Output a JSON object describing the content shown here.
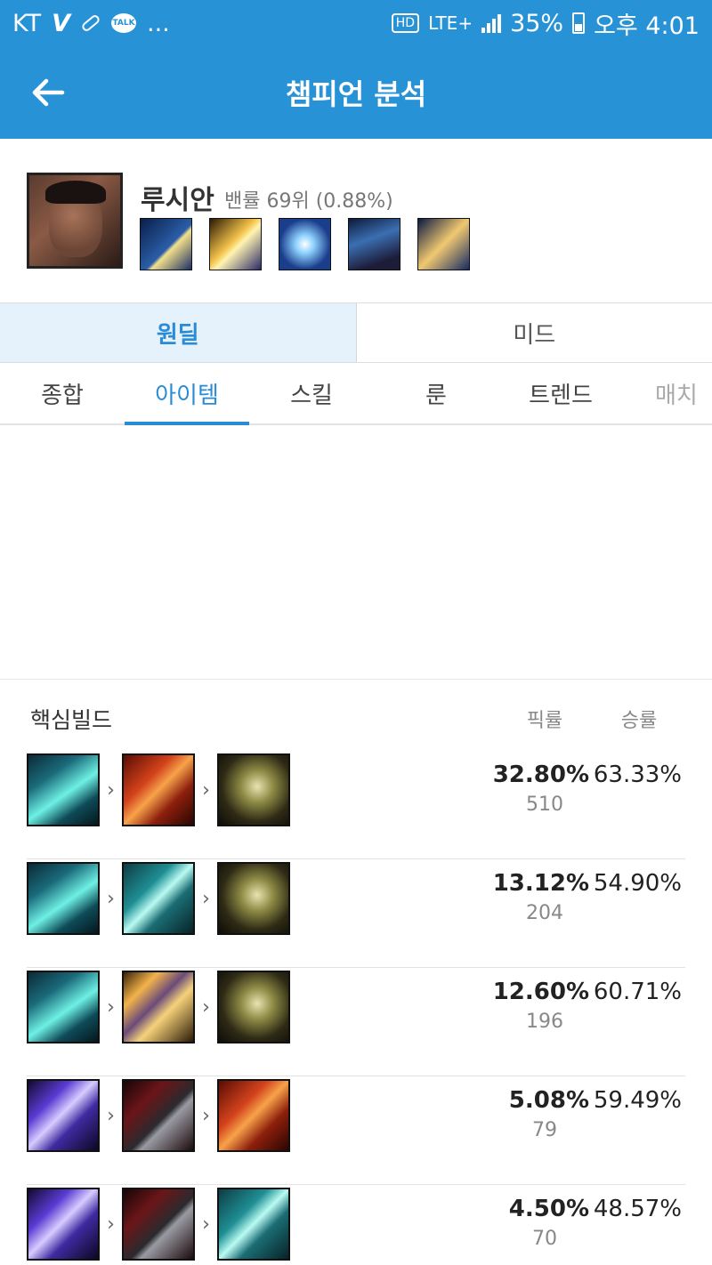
{
  "status_bar": {
    "carrier": "KT",
    "icons": [
      "v-icon",
      "pill-icon",
      "kakaotalk-icon"
    ],
    "kakao_label": "TALK",
    "more": "...",
    "hd": "HD",
    "network": "LTE+",
    "battery_pct": "35%",
    "time": "오후 4:01"
  },
  "app_bar": {
    "title": "챔피언 분석",
    "back_icon": "arrow-left-icon"
  },
  "champion": {
    "name": "루시안",
    "ban_info": "밴률 69위 (0.88%)",
    "skills": [
      "passive-lightslinger",
      "q-piercing-light",
      "w-ardent-blaze",
      "e-relentless-pursuit",
      "r-the-culling"
    ]
  },
  "roles": [
    {
      "label": "원딜",
      "active": true
    },
    {
      "label": "미드",
      "active": false
    }
  ],
  "tabs": [
    {
      "label": "종합",
      "active": false
    },
    {
      "label": "아이템",
      "active": true
    },
    {
      "label": "스킬",
      "active": false
    },
    {
      "label": "룬",
      "active": false
    },
    {
      "label": "트렌드",
      "active": false
    },
    {
      "label": "매치",
      "active": false
    }
  ],
  "core_build": {
    "title": "핵심빌드",
    "col_pick": "픽률",
    "col_win": "승률",
    "rows": [
      {
        "items": [
          "essence-reaver",
          "infinity-edge",
          "rapid-firecannon"
        ],
        "pick": "32.80%",
        "count": "510",
        "win": "63.33%"
      },
      {
        "items": [
          "essence-reaver",
          "navori-quickblades",
          "rapid-firecannon"
        ],
        "pick": "13.12%",
        "count": "204",
        "win": "54.90%"
      },
      {
        "items": [
          "essence-reaver",
          "statikk-shiv",
          "rapid-firecannon"
        ],
        "pick": "12.60%",
        "count": "196",
        "win": "60.71%"
      },
      {
        "items": [
          "blade-of-the-ruined-king",
          "black-cleaver",
          "infinity-edge"
        ],
        "pick": "5.08%",
        "count": "79",
        "win": "59.49%"
      },
      {
        "items": [
          "blade-of-the-ruined-king",
          "black-cleaver",
          "navori-quickblades"
        ],
        "pick": "4.50%",
        "count": "70",
        "win": "48.57%"
      }
    ]
  }
}
